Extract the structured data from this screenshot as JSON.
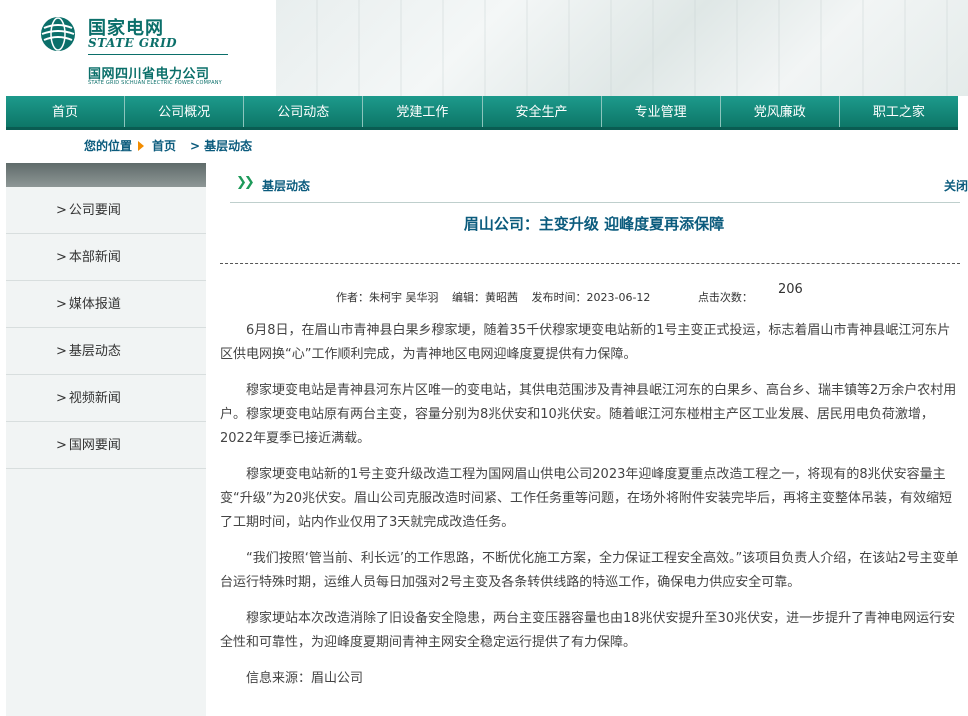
{
  "brand": {
    "name_cn": "国家电网",
    "name_en": "STATE GRID",
    "company_cn": "国网四川省电力公司",
    "company_en": "STATE GRID SICHUAN ELECTRIC POWER COMPANY"
  },
  "nav": [
    "首页",
    "公司概况",
    "公司动态",
    "党建工作",
    "安全生产",
    "专业管理",
    "党风廉政",
    "职工之家"
  ],
  "breadcrumb": {
    "label": "您的位置",
    "home": "首页",
    "current": "基层动态"
  },
  "sidebar": {
    "items": [
      "公司要闻",
      "本部新闻",
      "媒体报道",
      "基层动态",
      "视频新闻",
      "国网要闻"
    ]
  },
  "section": {
    "title": "基层动态",
    "close": "关闭"
  },
  "article": {
    "title": "眉山公司：主变升级 迎峰度夏再添保障",
    "author": "作者：朱柯宇 吴华羽",
    "editor": "编辑：黄昭茜",
    "date": "发布时间：2023-06-12",
    "clicks_label": "点击次数：",
    "clicks": "206",
    "paragraphs": [
      "6月8日，在眉山市青神县白果乡穆家埂，随着35千伏穆家埂变电站新的1号主变正式投运，标志着眉山市青神县岷江河东片区供电网换“心”工作顺利完成，为青神地区电网迎峰度夏提供有力保障。",
      "穆家埂变电站是青神县河东片区唯一的变电站，其供电范围涉及青神县岷江河东的白果乡、高台乡、瑞丰镇等2万余户农村用户。穆家埂变电站原有两台主变，容量分别为8兆伏安和10兆伏安。随着岷江河东椪柑主产区工业发展、居民用电负荷激增，2022年夏季已接近满载。",
      "穆家埂变电站新的1号主变升级改造工程为国网眉山供电公司2023年迎峰度夏重点改造工程之一，将现有的8兆伏安容量主变“升级”为20兆伏安。眉山公司克服改造时间紧、工作任务重等问题，在场外将附件安装完毕后，再将主变整体吊装，有效缩短了工期时间，站内作业仅用了3天就完成改造任务。",
      "“我们按照‘管当前、利长远’的工作思路，不断优化施工方案，全力保证工程安全高效。”该项目负责人介绍，在该站2号主变单台运行特殊时期，运维人员每日加强对2号主变及各条转供线路的特巡工作，确保电力供应安全可靠。",
      "穆家埂站本次改造消除了旧设备安全隐患，两台主变压器容量也由18兆伏安提升至30兆伏安，进一步提升了青神电网运行安全性和可靠性，为迎峰度夏期间青神主网安全稳定运行提供了有力保障。"
    ],
    "source": "信息来源：眉山公司"
  },
  "colors": {
    "nav_bg": "#0d7667",
    "brand": "#0b6f6a",
    "link": "#0b5b7d",
    "accent_arrow": "#f28c00"
  }
}
